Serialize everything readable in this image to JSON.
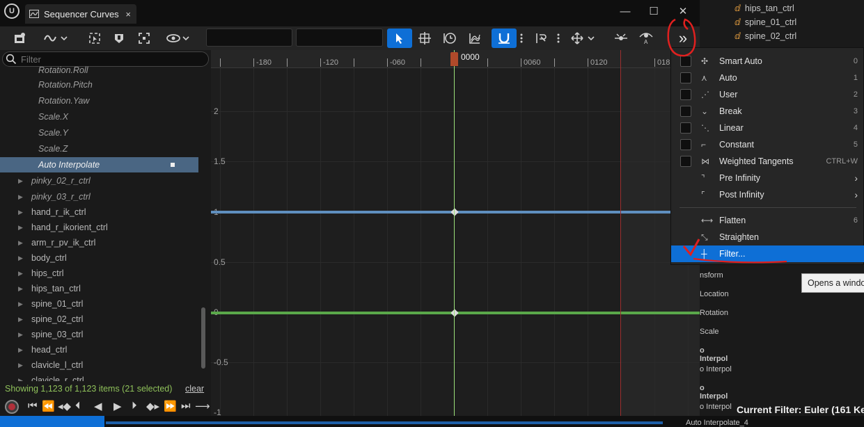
{
  "window": {
    "tab_title": "Sequencer Curves",
    "tab_close": "×",
    "minimize": "—",
    "maximize": "☐",
    "close": "✕",
    "logo": "U"
  },
  "toolbar": {
    "overflow_glyph": "»",
    "icons": [
      "curve-editor-icon",
      "curve-dropdown-icon",
      "frame-selection-icon",
      "frame-selected-icon",
      "frame-all-icon",
      "view-options-icon",
      "select-tool-icon",
      "transform-tool-icon",
      "retime-tool-icon",
      "multi-scale-tool-icon",
      "snapping-icon",
      "more-icon",
      "tangent-icon",
      "more-icon-2",
      "move-icon",
      "flatten-icon",
      "auto-tangent-icon"
    ],
    "accent": "#0e6fd6"
  },
  "filter": {
    "placeholder": "Filter"
  },
  "tree": {
    "items": [
      {
        "label": "Rotation.Roll",
        "style": "italic"
      },
      {
        "label": "Rotation.Pitch",
        "style": "italic"
      },
      {
        "label": "Rotation.Yaw",
        "style": "italic"
      },
      {
        "label": "Scale.X",
        "style": "italic"
      },
      {
        "label": "Scale.Y",
        "style": "italic"
      },
      {
        "label": "Scale.Z",
        "style": "italic"
      },
      {
        "label": "Auto Interpolate",
        "style": "selected"
      },
      {
        "label": "pinky_02_r_ctrl",
        "style": "italic-arrow"
      },
      {
        "label": "pinky_03_r_ctrl",
        "style": "italic-arrow"
      },
      {
        "label": "hand_r_ik_ctrl",
        "style": "arrow"
      },
      {
        "label": "hand_r_ikorient_ctrl",
        "style": "arrow"
      },
      {
        "label": "arm_r_pv_ik_ctrl",
        "style": "arrow"
      },
      {
        "label": "body_ctrl",
        "style": "arrow"
      },
      {
        "label": "hips_ctrl",
        "style": "arrow"
      },
      {
        "label": "hips_tan_ctrl",
        "style": "arrow"
      },
      {
        "label": "spine_01_ctrl",
        "style": "arrow"
      },
      {
        "label": "spine_02_ctrl",
        "style": "arrow"
      },
      {
        "label": "spine_03_ctrl",
        "style": "arrow"
      },
      {
        "label": "head_ctrl",
        "style": "arrow"
      },
      {
        "label": "clavicle_l_ctrl",
        "style": "arrow"
      },
      {
        "label": "clavicle_r_ctrl",
        "style": "arrow"
      }
    ],
    "status": "Showing 1,123 of 1,123 items (21 selected)",
    "clear": "clear"
  },
  "graph": {
    "ruler_labels": [
      "-180",
      "-120",
      "-060",
      "0000",
      "0060",
      "0120",
      "018"
    ],
    "y_labels": [
      "2",
      "1.5",
      "1",
      "0.5",
      "0",
      "-0.5",
      "-1"
    ],
    "playhead": "0000",
    "curve_colors": {
      "blue": "#5f8fbf",
      "green": "#5aa84a"
    }
  },
  "right_panel": {
    "tree": [
      "hips_tan_ctrl",
      "spine_01_ctrl",
      "spine_02_ctrl"
    ],
    "strip": [
      "nsform",
      "Location",
      "Rotation",
      "Scale",
      "o Interpol",
      "o Interpol",
      "o Interpol",
      "o Interpol"
    ],
    "current_filter": "Current Filter: Euler (161 Ke",
    "bottom_item": "Auto Interpolate_4"
  },
  "menu": {
    "items": [
      {
        "label": "Smart Auto",
        "shortcut": "0",
        "checkbox": true
      },
      {
        "label": "Auto",
        "shortcut": "1",
        "checkbox": true
      },
      {
        "label": "User",
        "shortcut": "2",
        "checkbox": true
      },
      {
        "label": "Break",
        "shortcut": "3",
        "checkbox": true
      },
      {
        "label": "Linear",
        "shortcut": "4",
        "checkbox": true
      },
      {
        "label": "Constant",
        "shortcut": "5",
        "checkbox": true
      },
      {
        "label": "Weighted Tangents",
        "shortcut": "CTRL+W",
        "checkbox": true
      },
      {
        "label": "Pre Infinity",
        "shortcut": "",
        "checkbox": false,
        "submenu": true
      },
      {
        "label": "Post Infinity",
        "shortcut": "",
        "checkbox": false,
        "submenu": true
      },
      {
        "label": "Flatten",
        "shortcut": "6",
        "checkbox": false
      },
      {
        "label": "Straighten",
        "shortcut": "",
        "checkbox": false
      },
      {
        "label": "Filter...",
        "shortcut": "",
        "checkbox": false,
        "highlighted": true
      }
    ]
  },
  "tooltip": "Opens a window",
  "annotation_color": "#e0201f"
}
